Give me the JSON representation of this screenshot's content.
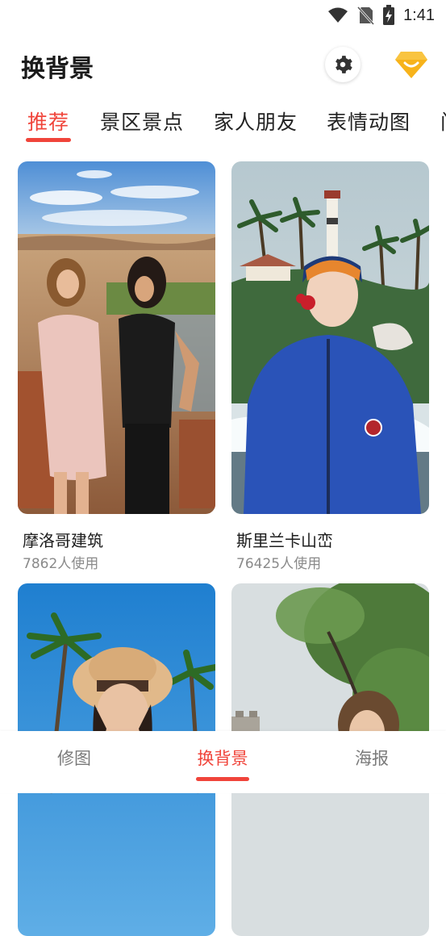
{
  "status_bar": {
    "time": "1:41",
    "icons": [
      "wifi-icon",
      "no-sim-icon",
      "battery-charging-icon"
    ]
  },
  "header": {
    "title": "换背景",
    "settings_icon": "gear-icon",
    "vip_icon": "diamond-vip-icon",
    "vip_color": "#f7b31b"
  },
  "tabs": [
    {
      "label": "推荐",
      "active": true
    },
    {
      "label": "景区景点",
      "active": false
    },
    {
      "label": "家人朋友",
      "active": false
    },
    {
      "label": "表情动图",
      "active": false
    },
    {
      "label": "门",
      "active": false
    }
  ],
  "cards": [
    {
      "title": "摩洛哥建筑",
      "usage": "7862人使用"
    },
    {
      "title": "斯里兰卡山峦",
      "usage": "76425人使用"
    },
    {
      "title": "",
      "usage": ""
    },
    {
      "title": "",
      "usage": ""
    }
  ],
  "bottom_nav": [
    {
      "label": "修图",
      "active": false
    },
    {
      "label": "换背景",
      "active": true
    },
    {
      "label": "海报",
      "active": false
    }
  ],
  "colors": {
    "accent": "#f0443a",
    "text_primary": "#1a1a1a",
    "text_secondary": "#8a8a8a"
  }
}
